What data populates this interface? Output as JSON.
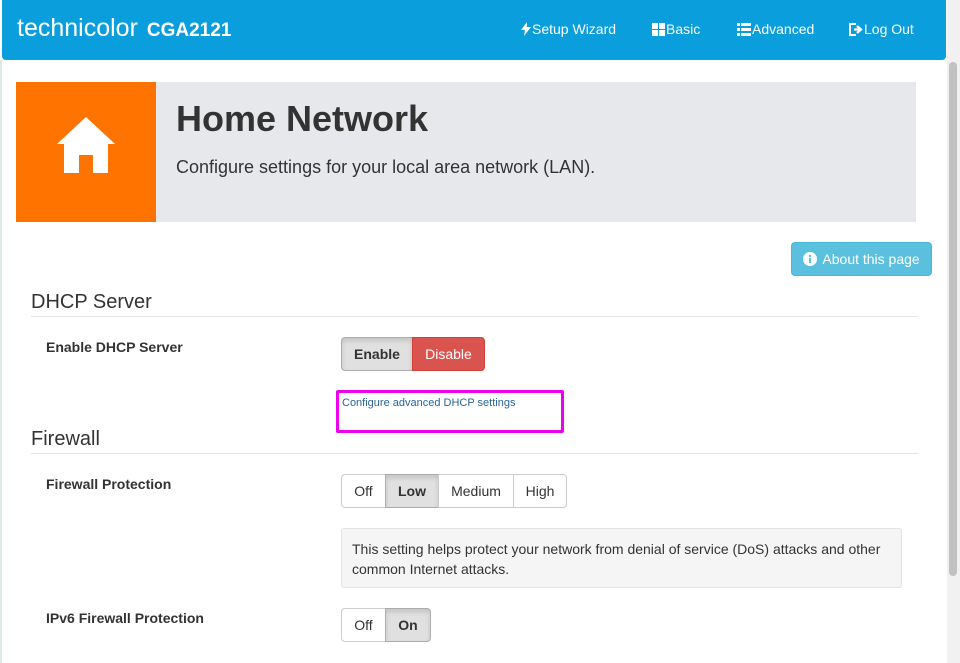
{
  "navbar": {
    "brand_name": "technicolor",
    "model": "CGA2121",
    "items": [
      {
        "label": "Setup Wizard",
        "icon": "lightning-icon"
      },
      {
        "label": "Basic",
        "icon": "grid-icon"
      },
      {
        "label": "Advanced",
        "icon": "list-icon"
      },
      {
        "label": "Log Out",
        "icon": "logout-icon"
      }
    ]
  },
  "hero": {
    "icon": "home-icon",
    "title": "Home Network",
    "subtitle": "Configure settings for your local area network (LAN)."
  },
  "about_button": {
    "label": "About this page",
    "icon": "info-icon"
  },
  "dhcp": {
    "section_title": "DHCP Server",
    "enable_label": "Enable DHCP Server",
    "options": [
      "Enable",
      "Disable"
    ],
    "selected": "Disable",
    "advanced_link": "Configure advanced DHCP settings"
  },
  "firewall": {
    "section_title": "Firewall",
    "protection_label": "Firewall Protection",
    "protection_options": [
      "Off",
      "Low",
      "Medium",
      "High"
    ],
    "protection_selected": "Low",
    "help_text": "This setting helps protect your network from denial of service (DoS) attacks and other common Internet attacks.",
    "ipv6_label": "IPv6 Firewall Protection",
    "ipv6_options": [
      "Off",
      "On"
    ],
    "ipv6_selected": "On"
  },
  "colors": {
    "navbar": "#0a9fdc",
    "hero_icon_bg": "#ff7300",
    "hero_panel_bg": "#e6e8ec",
    "info_button": "#5bc0de",
    "danger_button": "#d9534f",
    "highlight": "#ee00ee"
  }
}
